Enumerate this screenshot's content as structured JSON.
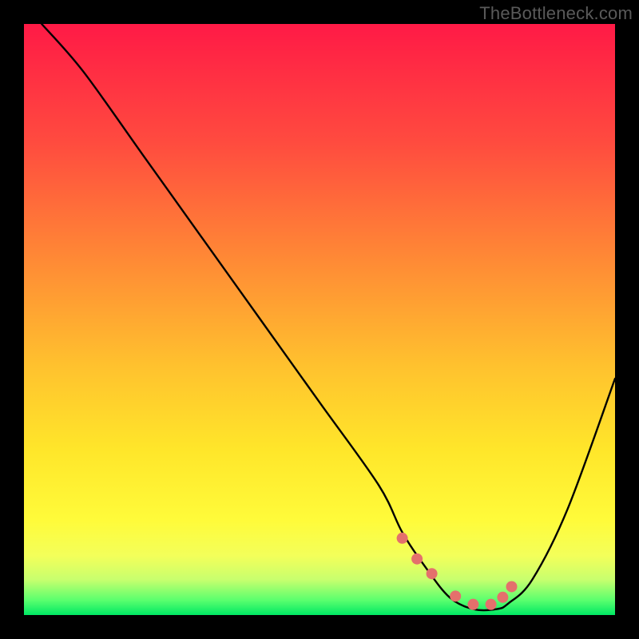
{
  "watermark": "TheBottleneck.com",
  "chart_data": {
    "type": "line",
    "title": "",
    "xlabel": "",
    "ylabel": "",
    "xlim": [
      0,
      100
    ],
    "ylim": [
      0,
      100
    ],
    "series": [
      {
        "name": "bottleneck-curve",
        "x": [
          3,
          10,
          20,
          30,
          40,
          50,
          60,
          64,
          68,
          72,
          76,
          80,
          82,
          86,
          92,
          100
        ],
        "y": [
          100,
          92,
          78,
          64,
          50,
          36,
          22,
          14,
          8,
          3,
          1,
          1,
          2,
          6,
          18,
          40
        ]
      }
    ],
    "highlight": {
      "name": "optimal-region",
      "x": [
        64,
        66.5,
        69,
        73,
        76,
        79,
        81,
        82.5
      ],
      "y": [
        13,
        9.5,
        7,
        3.2,
        1.8,
        1.8,
        3,
        4.8
      ]
    },
    "gradient_stops": [
      {
        "offset": 0.0,
        "color": "#ff1a46"
      },
      {
        "offset": 0.2,
        "color": "#ff4b3f"
      },
      {
        "offset": 0.4,
        "color": "#ff8a35"
      },
      {
        "offset": 0.58,
        "color": "#ffc22e"
      },
      {
        "offset": 0.72,
        "color": "#ffe62a"
      },
      {
        "offset": 0.84,
        "color": "#fffb3a"
      },
      {
        "offset": 0.9,
        "color": "#f3ff5a"
      },
      {
        "offset": 0.94,
        "color": "#c8ff6e"
      },
      {
        "offset": 0.975,
        "color": "#5aff6e"
      },
      {
        "offset": 1.0,
        "color": "#00e864"
      }
    ]
  }
}
